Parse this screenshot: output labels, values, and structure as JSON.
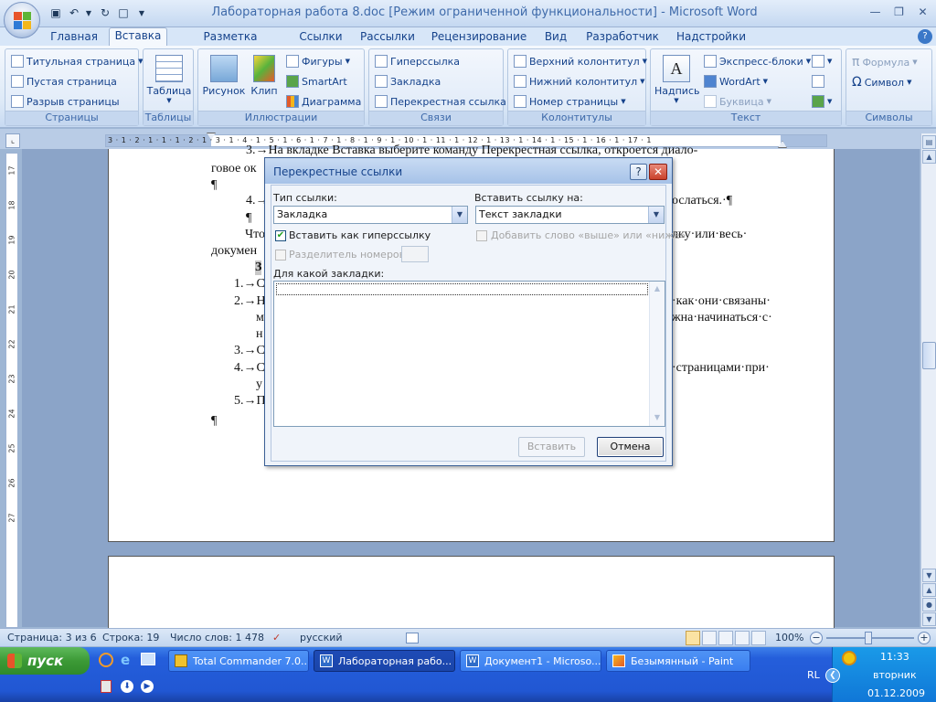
{
  "window": {
    "title": "Лабораторная работа 8.doc [Режим ограниченной функциональности] - Microsoft Word"
  },
  "tabs": [
    "Главная",
    "Вставка",
    "Разметка страницы",
    "Ссылки",
    "Рассылки",
    "Рецензирование",
    "Вид",
    "Разработчик",
    "Надстройки"
  ],
  "active_tab": "Вставка",
  "ribbon": {
    "pages": {
      "label": "Страницы",
      "items": [
        "Титульная страница",
        "Пустая страница",
        "Разрыв страницы"
      ]
    },
    "tables": {
      "label": "Таблицы",
      "items": [
        "Таблица"
      ]
    },
    "illustrations": {
      "label": "Иллюстрации",
      "items": [
        "Рисунок",
        "Клип",
        "Фигуры",
        "SmartArt",
        "Диаграмма"
      ]
    },
    "links": {
      "label": "Связи",
      "items": [
        "Гиперссылка",
        "Закладка",
        "Перекрестная ссылка"
      ]
    },
    "headers": {
      "label": "Колонтитулы",
      "items": [
        "Верхний колонтитул",
        "Нижний колонтитул",
        "Номер страницы"
      ]
    },
    "text": {
      "label": "Текст",
      "items": [
        "Надпись",
        "Экспресс-блоки",
        "WordArt",
        "Буквица"
      ]
    },
    "symbols": {
      "label": "Символы",
      "items": [
        "Формула",
        "Символ"
      ]
    }
  },
  "ruler": {
    "numbers": "3 · 1 · 2 · 1 · 1 · 1 · 2 · 1 · 3 · 1 · 4 · 1 · 5 · 1 · 6 · 1 · 7 · 1 · 8 · 1 · 9 · 1 · 10 · 1 · 11 · 1 · 12 · 1 · 13 · 1 · 14 · 1 · 15 · 1 · 16 · 1 · 17 · 1",
    "vnumbers": [
      "17",
      "18",
      "19",
      "20",
      "21",
      "22",
      "23",
      "24",
      "25",
      "26",
      "27"
    ]
  },
  "document": {
    "lines": [
      "3.→На вкладке Вставка выберите команду Перекрестная ссылка, откроется диало-",
      "говое ок",
      "¶",
      "4.→",
      "ослаться.·¶",
      "¶",
      "Что",
      "лку·или·весь·",
      "докумен",
      "З",
      "1.→С",
      "2.→Н",
      "·как·они·связаны·",
      "м",
      "жна·начинаться·с·",
      "н",
      "3.→С",
      "4.→С",
      "·страницами·при·",
      "у",
      "5.→П",
      "¶"
    ]
  },
  "dialog": {
    "title": "Перекрестные ссылки",
    "link_type_label": "Тип ссылки:",
    "link_type_value": "Закладка",
    "insert_ref_label": "Вставить ссылку на:",
    "insert_ref_value": "Текст закладки",
    "hyperlink_checkbox": "Вставить как гиперссылку",
    "hyperlink_checked": true,
    "above_below_checkbox": "Добавить слово «выше» или «ниже»",
    "separator_label": "Разделитель номеров",
    "which_label": "Для какой закладки:",
    "insert_button": "Вставить",
    "cancel_button": "Отмена"
  },
  "status": {
    "page": "Страница: 3 из 6",
    "line": "Строка: 19",
    "words": "Число слов: 1 478",
    "language": "русский",
    "zoom": "100%"
  },
  "taskbar": {
    "start": "пуск",
    "buttons": [
      "Total Commander 7.0...",
      "Лабораторная рабо...",
      "Документ1 - Microso...",
      "Безымянный - Paint"
    ],
    "active": "Лабораторная рабо...",
    "tray": {
      "lang": "RL",
      "time": "11:33",
      "day": "вторник",
      "date": "01.12.2009"
    }
  }
}
